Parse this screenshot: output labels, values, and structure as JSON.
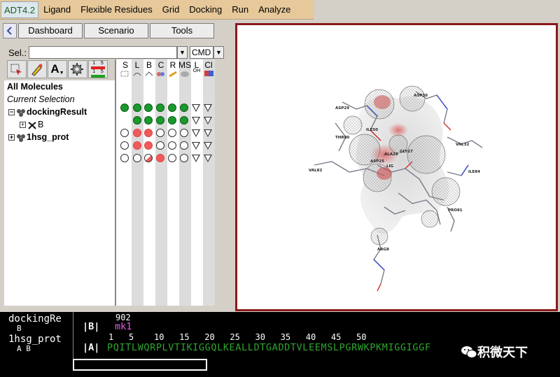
{
  "menubar": {
    "app_label": "ADT4.2",
    "items": [
      "Ligand",
      "Flexible Residues",
      "Grid",
      "Docking",
      "Run",
      "Analyze"
    ]
  },
  "left_panel": {
    "tabs": [
      "Dashboard",
      "Scenario",
      "Tools"
    ],
    "selection_label": "Sel.:",
    "selection_value": "",
    "command_value": "CMD",
    "column_headers": [
      "S",
      "L",
      "B",
      "C",
      "R",
      "MS",
      "L",
      "Cl"
    ],
    "column_subheaders": [
      "",
      "",
      "",
      "",
      "",
      "",
      "OH",
      ""
    ],
    "tree": {
      "all_molecules": "All Molecules",
      "current_selection": "Current Selection",
      "items": [
        {
          "label": "dockingResult",
          "chain": "B"
        },
        {
          "label": "1hsg_prot"
        }
      ]
    },
    "icon_text": {
      "text_tool": "A",
      "numbering_top": "1    5",
      "numbering_bottom": "1    5"
    }
  },
  "viewer": {
    "residue_labels": [
      "ASP29",
      "ASP30",
      "GLY27",
      "ASP25",
      "LIG",
      "ILE50",
      "VAL32",
      "VAL82",
      "ILE84",
      "PRO81",
      "ARG8",
      "THR80",
      "ALA28"
    ]
  },
  "sequence": {
    "molecules": [
      {
        "name": "dockingRe",
        "chains": "B"
      },
      {
        "name": "1hsg_prot",
        "chains": "A B"
      }
    ],
    "ruler_top": "902",
    "ruler_main": "1   5    10   15   20   25   30   35   40   45   50",
    "chain_b_tag": "|B|",
    "chain_b_seq": "mk1",
    "chain_a_tag": "|A|",
    "chain_a_seq": "PQITLWQRPLVTIKIGGQLKEALLDTGADDTVLEEMSLPGRWKPKMIGGIGGF",
    "watermark": "积微天下"
  },
  "colors": {
    "menubar": "#e6c89a",
    "viewer_border": "#8b1a1a",
    "dot_green": "#1a9a2c",
    "dot_red": "#f25a5a",
    "seq_green": "#2ea52e",
    "seq_magenta": "#e060e0"
  }
}
